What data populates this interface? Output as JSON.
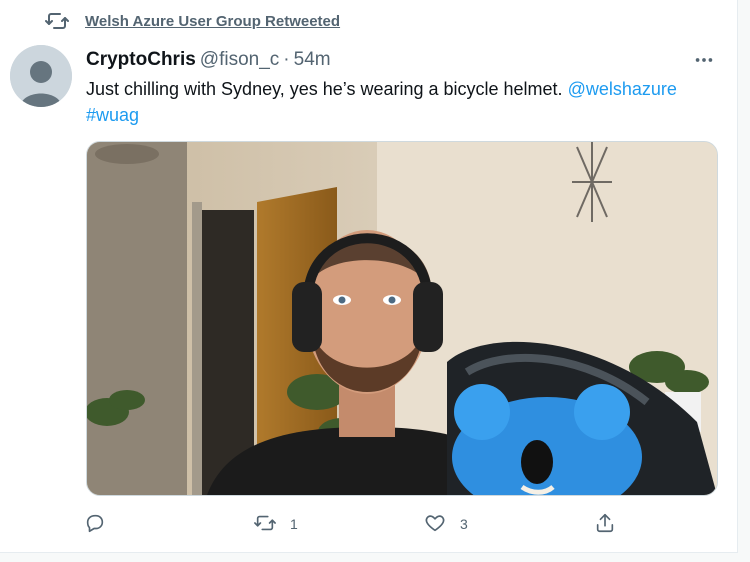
{
  "retweet_banner": {
    "icon": "retweet-icon",
    "text": "Welsh Azure User Group Retweeted"
  },
  "tweet": {
    "author_name": "CryptoChris",
    "author_handle": "@fison_c",
    "separator": "·",
    "time": "54m",
    "text_main": "Just chilling with Sydney, yes he’s wearing a bicycle helmet.",
    "mention": "@welshazure",
    "hashtag": "#wuag",
    "image_description_icon": "photo-icon"
  },
  "actions": {
    "reply": {
      "icon": "reply-icon",
      "count": ""
    },
    "retweet": {
      "icon": "retweet-icon",
      "count": "1"
    },
    "like": {
      "icon": "heart-icon",
      "count": "3"
    },
    "share": {
      "icon": "share-icon",
      "count": ""
    }
  },
  "colors": {
    "link": "#1d9bf0",
    "muted": "#536471",
    "text": "#0f1419"
  }
}
